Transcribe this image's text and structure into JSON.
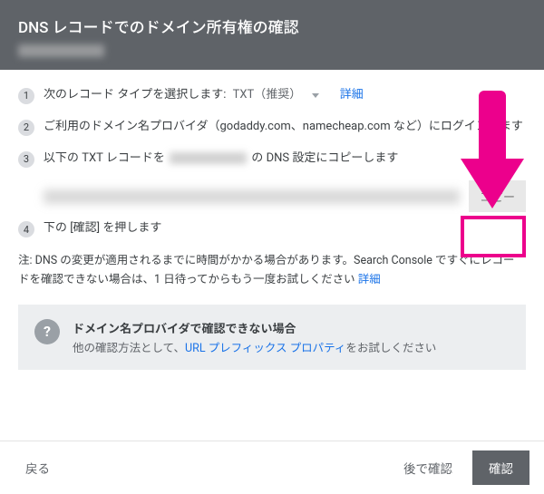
{
  "header": {
    "title": "DNS レコードでのドメイン所有権の確認"
  },
  "steps": {
    "s1_prefix": "次のレコード タイプを選択します:",
    "s1_type": "TXT（推奨）",
    "s1_detail": "詳細",
    "s2": "ご利用のドメイン名プロバイダ（godaddy.com、namecheap.com など）にログインします",
    "s3_a": "以下の TXT レコードを",
    "s3_b": "の DNS 設定にコピーします",
    "s4": "下の [確認] を押します"
  },
  "copy_button": "コピー",
  "note": {
    "text": "注: DNS の変更が適用されるまでに時間がかかる場合があります。Search Console ですぐにレコードを確認できない場合は、1 日待ってからもう一度お試しください",
    "link": "詳細"
  },
  "info": {
    "title": "ドメイン名プロバイダで確認できない場合",
    "text_a": "他の確認方法として、",
    "link": "URL プレフィックス プロパティ",
    "text_b": "をお試しください"
  },
  "footer": {
    "back": "戻る",
    "later": "後で確認",
    "confirm": "確認"
  },
  "colors": {
    "accent_arrow": "#ec008c"
  }
}
